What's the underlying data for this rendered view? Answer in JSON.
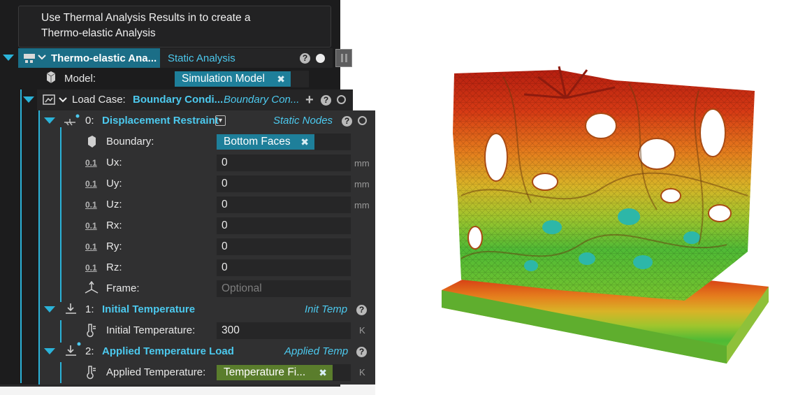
{
  "tooltip": {
    "line1": "Use Thermal Analysis Results in to create a",
    "line2": "Thermo-elastic Analysis"
  },
  "analysis": {
    "name": "Thermo-elastic Ana...",
    "type": "Static Analysis"
  },
  "model": {
    "label": "Model:",
    "value": "Simulation Model"
  },
  "load_case": {
    "label": "Load Case:",
    "name": "Boundary Condi...",
    "type": "Boundary Con..."
  },
  "restraint": {
    "index": "0:",
    "title": "Displacement Restraint",
    "type": "Static Nodes",
    "boundary_label": "Boundary:",
    "boundary_value": "Bottom Faces",
    "fields": [
      {
        "label": "Ux:",
        "value": "0",
        "unit": "mm"
      },
      {
        "label": "Uy:",
        "value": "0",
        "unit": "mm"
      },
      {
        "label": "Uz:",
        "value": "0",
        "unit": "mm"
      },
      {
        "label": "Rx:",
        "value": "0",
        "unit": ""
      },
      {
        "label": "Ry:",
        "value": "0",
        "unit": ""
      },
      {
        "label": "Rz:",
        "value": "0",
        "unit": ""
      }
    ],
    "frame_label": "Frame:",
    "frame_placeholder": "Optional"
  },
  "init_temp": {
    "index": "1:",
    "title": "Initial Temperature",
    "type": "Init Temp",
    "label": "Initial Temperature:",
    "value": "300",
    "unit": "K"
  },
  "applied_temp": {
    "index": "2:",
    "title": "Applied Temperature Load",
    "type": "Applied Temp",
    "label": "Applied Temperature:",
    "value": "Temperature Fi...",
    "unit": "K"
  },
  "icons": {
    "help": "?",
    "close": "✖",
    "value_icon": "0.1",
    "add": "+"
  },
  "colors": {
    "accent": "#4cc9ee",
    "tag": "#1e7f9a",
    "tag_green": "#5a7d2c",
    "panel": "#1c1c1d"
  }
}
